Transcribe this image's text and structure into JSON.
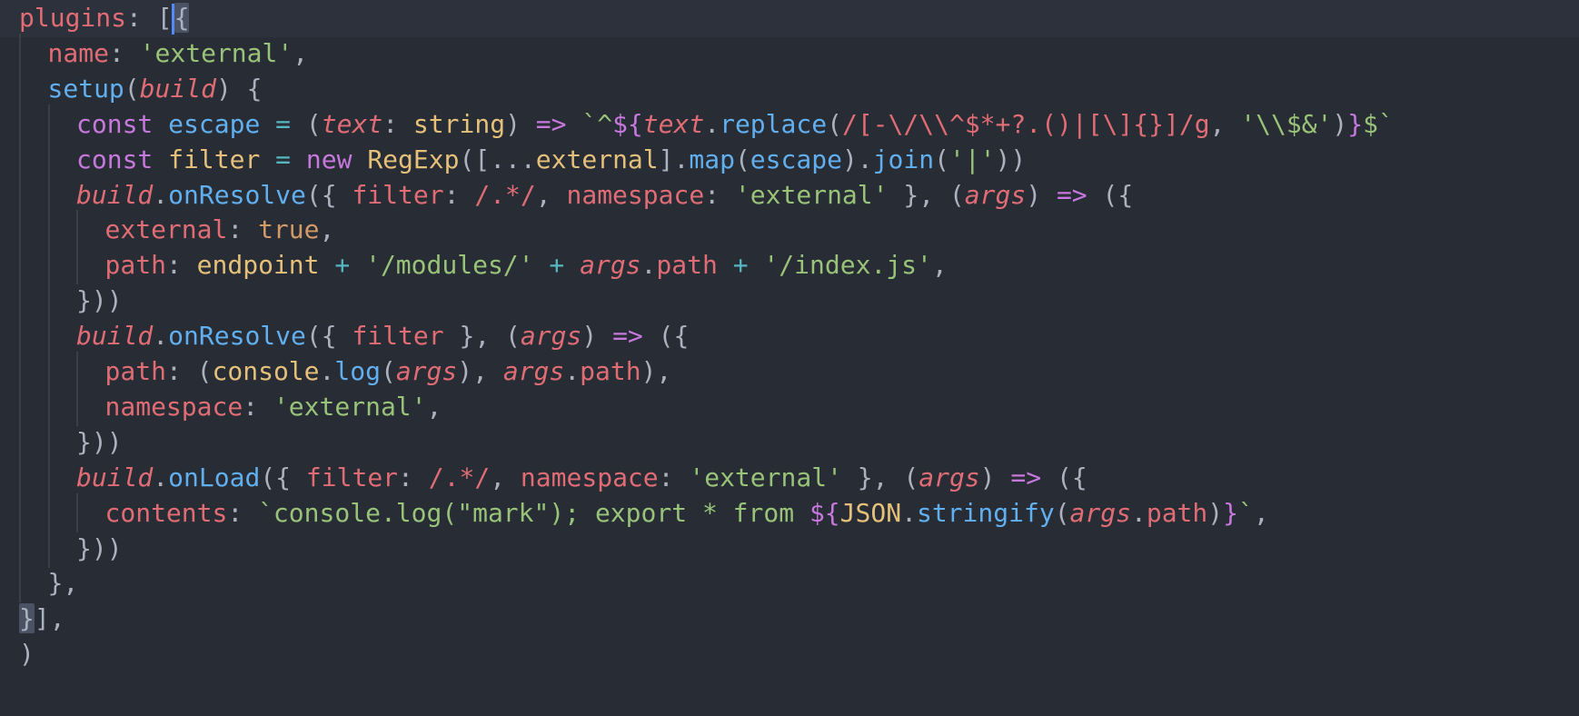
{
  "editor": {
    "theme_colors": {
      "background": "#282c34",
      "keyword": "#c678dd",
      "property": "#e06c75",
      "string": "#98c379",
      "function": "#61afef",
      "variable": "#e5c07b",
      "operator": "#56b6c2",
      "boolean": "#d19a66",
      "cursor": "#528bff"
    },
    "lines": [
      {
        "indent": 0,
        "tokens": [
          {
            "t": "plugins",
            "c": "p"
          },
          {
            "t": ": ",
            "c": "pu"
          },
          {
            "t": "[",
            "c": "pu"
          },
          {
            "t": "{",
            "c": "pu",
            "match": true,
            "cursor": true
          }
        ]
      },
      {
        "indent": 1,
        "tokens": [
          {
            "t": "name",
            "c": "p"
          },
          {
            "t": ": ",
            "c": "pu"
          },
          {
            "t": "'external'",
            "c": "s"
          },
          {
            "t": ",",
            "c": "pu"
          }
        ]
      },
      {
        "indent": 1,
        "tokens": [
          {
            "t": "setup",
            "c": "f"
          },
          {
            "t": "(",
            "c": "pu"
          },
          {
            "t": "build",
            "c": "pa"
          },
          {
            "t": ") {",
            "c": "pu"
          }
        ]
      },
      {
        "indent": 2,
        "tokens": [
          {
            "t": "const ",
            "c": "k"
          },
          {
            "t": "escape",
            "c": "f"
          },
          {
            "t": " = ",
            "c": "op"
          },
          {
            "t": "(",
            "c": "pu"
          },
          {
            "t": "text",
            "c": "pa"
          },
          {
            "t": ": ",
            "c": "pu"
          },
          {
            "t": "string",
            "c": "ty"
          },
          {
            "t": ") ",
            "c": "pu"
          },
          {
            "t": "=>",
            "c": "k"
          },
          {
            "t": " `^",
            "c": "s"
          },
          {
            "t": "${",
            "c": "tp"
          },
          {
            "t": "text",
            "c": "pa"
          },
          {
            "t": ".",
            "c": "pu"
          },
          {
            "t": "replace",
            "c": "f"
          },
          {
            "t": "(",
            "c": "pu"
          },
          {
            "t": "/[-\\/\\\\^$*+?.()|[\\]{}]/g",
            "c": "rx"
          },
          {
            "t": ", ",
            "c": "pu"
          },
          {
            "t": "'\\\\$&'",
            "c": "s"
          },
          {
            "t": ")",
            "c": "pu"
          },
          {
            "t": "}",
            "c": "tp"
          },
          {
            "t": "$`",
            "c": "s"
          }
        ]
      },
      {
        "indent": 2,
        "tokens": [
          {
            "t": "const ",
            "c": "k"
          },
          {
            "t": "filter",
            "c": "v"
          },
          {
            "t": " = ",
            "c": "op"
          },
          {
            "t": "new ",
            "c": "k"
          },
          {
            "t": "RegExp",
            "c": "v"
          },
          {
            "t": "([...",
            "c": "pu"
          },
          {
            "t": "external",
            "c": "v"
          },
          {
            "t": "].",
            "c": "pu"
          },
          {
            "t": "map",
            "c": "f"
          },
          {
            "t": "(",
            "c": "pu"
          },
          {
            "t": "escape",
            "c": "f"
          },
          {
            "t": ").",
            "c": "pu"
          },
          {
            "t": "join",
            "c": "f"
          },
          {
            "t": "(",
            "c": "pu"
          },
          {
            "t": "'|'",
            "c": "s"
          },
          {
            "t": "))",
            "c": "pu"
          }
        ]
      },
      {
        "indent": 2,
        "tokens": [
          {
            "t": "build",
            "c": "pa"
          },
          {
            "t": ".",
            "c": "pu"
          },
          {
            "t": "onResolve",
            "c": "f"
          },
          {
            "t": "({ ",
            "c": "pu"
          },
          {
            "t": "filter",
            "c": "p"
          },
          {
            "t": ": ",
            "c": "pu"
          },
          {
            "t": "/.*/",
            "c": "rx"
          },
          {
            "t": ", ",
            "c": "pu"
          },
          {
            "t": "namespace",
            "c": "p"
          },
          {
            "t": ": ",
            "c": "pu"
          },
          {
            "t": "'external'",
            "c": "s"
          },
          {
            "t": " }, (",
            "c": "pu"
          },
          {
            "t": "args",
            "c": "pa"
          },
          {
            "t": ") ",
            "c": "pu"
          },
          {
            "t": "=>",
            "c": "k"
          },
          {
            "t": " ({",
            "c": "pu"
          }
        ]
      },
      {
        "indent": 3,
        "tokens": [
          {
            "t": "external",
            "c": "p"
          },
          {
            "t": ": ",
            "c": "pu"
          },
          {
            "t": "true",
            "c": "bo"
          },
          {
            "t": ",",
            "c": "pu"
          }
        ]
      },
      {
        "indent": 3,
        "tokens": [
          {
            "t": "path",
            "c": "p"
          },
          {
            "t": ": ",
            "c": "pu"
          },
          {
            "t": "endpoint",
            "c": "v"
          },
          {
            "t": " + ",
            "c": "op"
          },
          {
            "t": "'/modules/'",
            "c": "s"
          },
          {
            "t": " + ",
            "c": "op"
          },
          {
            "t": "args",
            "c": "pa"
          },
          {
            "t": ".",
            "c": "pu"
          },
          {
            "t": "path",
            "c": "p"
          },
          {
            "t": " + ",
            "c": "op"
          },
          {
            "t": "'/index.js'",
            "c": "s"
          },
          {
            "t": ",",
            "c": "pu"
          }
        ]
      },
      {
        "indent": 2,
        "tokens": [
          {
            "t": "}))",
            "c": "pu"
          }
        ]
      },
      {
        "indent": 2,
        "tokens": [
          {
            "t": "build",
            "c": "pa"
          },
          {
            "t": ".",
            "c": "pu"
          },
          {
            "t": "onResolve",
            "c": "f"
          },
          {
            "t": "({ ",
            "c": "pu"
          },
          {
            "t": "filter",
            "c": "p"
          },
          {
            "t": " }, (",
            "c": "pu"
          },
          {
            "t": "args",
            "c": "pa"
          },
          {
            "t": ") ",
            "c": "pu"
          },
          {
            "t": "=>",
            "c": "k"
          },
          {
            "t": " ({",
            "c": "pu"
          }
        ]
      },
      {
        "indent": 3,
        "tokens": [
          {
            "t": "path",
            "c": "p"
          },
          {
            "t": ": (",
            "c": "pu"
          },
          {
            "t": "console",
            "c": "v"
          },
          {
            "t": ".",
            "c": "pu"
          },
          {
            "t": "log",
            "c": "f"
          },
          {
            "t": "(",
            "c": "pu"
          },
          {
            "t": "args",
            "c": "pa"
          },
          {
            "t": "), ",
            "c": "pu"
          },
          {
            "t": "args",
            "c": "pa"
          },
          {
            "t": ".",
            "c": "pu"
          },
          {
            "t": "path",
            "c": "p"
          },
          {
            "t": "),",
            "c": "pu"
          }
        ]
      },
      {
        "indent": 3,
        "tokens": [
          {
            "t": "namespace",
            "c": "p"
          },
          {
            "t": ": ",
            "c": "pu"
          },
          {
            "t": "'external'",
            "c": "s"
          },
          {
            "t": ",",
            "c": "pu"
          }
        ]
      },
      {
        "indent": 2,
        "tokens": [
          {
            "t": "}))",
            "c": "pu"
          }
        ]
      },
      {
        "indent": 2,
        "tokens": [
          {
            "t": "build",
            "c": "pa"
          },
          {
            "t": ".",
            "c": "pu"
          },
          {
            "t": "onLoad",
            "c": "f"
          },
          {
            "t": "({ ",
            "c": "pu"
          },
          {
            "t": "filter",
            "c": "p"
          },
          {
            "t": ": ",
            "c": "pu"
          },
          {
            "t": "/.*/",
            "c": "rx"
          },
          {
            "t": ", ",
            "c": "pu"
          },
          {
            "t": "namespace",
            "c": "p"
          },
          {
            "t": ": ",
            "c": "pu"
          },
          {
            "t": "'external'",
            "c": "s"
          },
          {
            "t": " }, (",
            "c": "pu"
          },
          {
            "t": "args",
            "c": "pa"
          },
          {
            "t": ") ",
            "c": "pu"
          },
          {
            "t": "=>",
            "c": "k"
          },
          {
            "t": " ({",
            "c": "pu"
          }
        ]
      },
      {
        "indent": 3,
        "tokens": [
          {
            "t": "contents",
            "c": "p"
          },
          {
            "t": ": ",
            "c": "pu"
          },
          {
            "t": "`console.log(\"mark\"); export * from ",
            "c": "s"
          },
          {
            "t": "${",
            "c": "tp"
          },
          {
            "t": "JSON",
            "c": "v"
          },
          {
            "t": ".",
            "c": "pu"
          },
          {
            "t": "stringify",
            "c": "f"
          },
          {
            "t": "(",
            "c": "pu"
          },
          {
            "t": "args",
            "c": "pa"
          },
          {
            "t": ".",
            "c": "pu"
          },
          {
            "t": "path",
            "c": "p"
          },
          {
            "t": ")",
            "c": "pu"
          },
          {
            "t": "}",
            "c": "tp"
          },
          {
            "t": "`",
            "c": "s"
          },
          {
            "t": ",",
            "c": "pu"
          }
        ]
      },
      {
        "indent": 2,
        "tokens": [
          {
            "t": "}))",
            "c": "pu"
          }
        ]
      },
      {
        "indent": 1,
        "tokens": [
          {
            "t": "},",
            "c": "pu"
          }
        ]
      },
      {
        "indent": 0,
        "tokens": [
          {
            "t": "}",
            "c": "pu",
            "match": true
          },
          {
            "t": "],",
            "c": "pu"
          }
        ]
      },
      {
        "indent": 0,
        "tokens": [
          {
            "t": ")",
            "c": "pu"
          }
        ]
      }
    ]
  }
}
